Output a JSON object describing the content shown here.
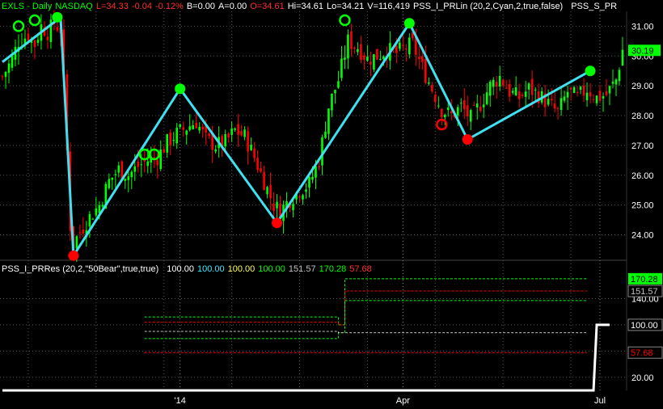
{
  "header_top": {
    "symbol": "EXLS - Daily",
    "exchange": "NASDAQ",
    "last": "L=34.33",
    "change": "-0.04",
    "change_pct": "-0.12%",
    "bid": "B=0.00",
    "ask": "A=0.00",
    "open": "O=34.61",
    "high": "Hi=34.61",
    "low": "Lo=34.21",
    "volume": "V=116,419",
    "study1": "PSS_I_PRLin (20,2,Cyan,2,true,false)",
    "study2": "PSS_S_PR"
  },
  "header_bottom": {
    "study": "PSS_I_PRRes (20,2,\"50Bear\",true,true)",
    "v1": "100.00",
    "v2": "100.00",
    "v3": "100.00",
    "v4": "100.00",
    "v5": "151.57",
    "v6": "170.28",
    "v7": "57.68"
  },
  "colors": {
    "background": "#000000",
    "up": "#00ff00",
    "down": "#ff0000",
    "line": "#3fe0f0",
    "header_green": "#00ff00",
    "header_red": "#ff3030",
    "header_white": "#ffffff",
    "cyan_text": "#40e8ff",
    "yellow_text": "#ffff60",
    "gray_text": "#c0c0c0",
    "price_badge": "#00ff00",
    "grid": "#555555"
  },
  "chart_data": [
    {
      "type": "candlestick",
      "x_tick_labels": [
        "'14",
        "Apr",
        "Jul"
      ],
      "y_ticks": [
        "31.00",
        "30.00",
        "29.00",
        "28.00",
        "27.00",
        "26.00",
        "25.00",
        "24.00"
      ],
      "ylim": [
        23.2,
        31.5
      ],
      "last_price_label": "30.19",
      "zigzag": [
        {
          "bar": 0,
          "value": 29.8
        },
        {
          "bar": 18,
          "value": 31.3
        },
        {
          "bar": 22,
          "value": 23.3
        },
        {
          "bar": 55,
          "value": 28.9
        },
        {
          "bar": 85,
          "value": 24.4
        },
        {
          "bar": 126,
          "value": 31.1
        },
        {
          "bar": 144,
          "value": 27.2
        },
        {
          "bar": 182,
          "value": 29.5
        }
      ],
      "pivot_markers": [
        {
          "bar": 5,
          "value": 31.0,
          "color": "up",
          "filled": false
        },
        {
          "bar": 10,
          "value": 31.2,
          "color": "up",
          "filled": false
        },
        {
          "bar": 17,
          "value": 31.3,
          "color": "up",
          "filled": true
        },
        {
          "bar": 22,
          "value": 23.3,
          "color": "down",
          "filled": true
        },
        {
          "bar": 44,
          "value": 26.7,
          "color": "up",
          "filled": false
        },
        {
          "bar": 47,
          "value": 26.7,
          "color": "up",
          "filled": false
        },
        {
          "bar": 55,
          "value": 28.9,
          "color": "up",
          "filled": true
        },
        {
          "bar": 85,
          "value": 24.4,
          "color": "down",
          "filled": true
        },
        {
          "bar": 106,
          "value": 31.2,
          "color": "up",
          "filled": false
        },
        {
          "bar": 126,
          "value": 31.1,
          "color": "up",
          "filled": true
        },
        {
          "bar": 136,
          "value": 27.7,
          "color": "down",
          "filled": false
        },
        {
          "bar": 144,
          "value": 27.2,
          "color": "down",
          "filled": true
        },
        {
          "bar": 182,
          "value": 29.5,
          "color": "up",
          "filled": true
        }
      ],
      "price_path": [
        [
          0,
          29.3
        ],
        [
          3,
          29.9
        ],
        [
          5,
          30.5
        ],
        [
          8,
          30.7
        ],
        [
          10,
          30.4
        ],
        [
          12,
          31.0
        ],
        [
          14,
          30.8
        ],
        [
          16,
          31.1
        ],
        [
          18,
          30.9
        ],
        [
          19,
          29.3
        ],
        [
          21,
          24.3
        ],
        [
          22,
          23.7
        ],
        [
          24,
          24.1
        ],
        [
          27,
          24.6
        ],
        [
          30,
          25.0
        ],
        [
          33,
          25.8
        ],
        [
          36,
          26.2
        ],
        [
          39,
          26.0
        ],
        [
          42,
          26.3
        ],
        [
          45,
          26.5
        ],
        [
          48,
          26.6
        ],
        [
          51,
          27.1
        ],
        [
          54,
          27.4
        ],
        [
          57,
          27.6
        ],
        [
          60,
          27.8
        ],
        [
          63,
          27.2
        ],
        [
          66,
          27.0
        ],
        [
          69,
          27.1
        ],
        [
          72,
          27.5
        ],
        [
          75,
          27.3
        ],
        [
          78,
          26.6
        ],
        [
          81,
          25.8
        ],
        [
          84,
          25.0
        ],
        [
          86,
          24.8
        ],
        [
          89,
          25.2
        ],
        [
          92,
          25.5
        ],
        [
          95,
          25.7
        ],
        [
          98,
          26.5
        ],
        [
          101,
          28.3
        ],
        [
          104,
          29.2
        ],
        [
          107,
          30.5
        ],
        [
          110,
          30.3
        ],
        [
          113,
          29.9
        ],
        [
          116,
          30.0
        ],
        [
          119,
          30.2
        ],
        [
          122,
          30.1
        ],
        [
          125,
          30.3
        ],
        [
          127,
          30.4
        ],
        [
          130,
          29.6
        ],
        [
          133,
          28.9
        ],
        [
          136,
          28.2
        ],
        [
          139,
          28.0
        ],
        [
          142,
          28.3
        ],
        [
          145,
          27.9
        ],
        [
          148,
          28.4
        ],
        [
          151,
          29.0
        ],
        [
          154,
          29.3
        ],
        [
          157,
          28.8
        ],
        [
          160,
          28.6
        ],
        [
          163,
          28.9
        ],
        [
          166,
          28.7
        ],
        [
          169,
          28.4
        ],
        [
          172,
          28.1
        ],
        [
          175,
          28.8
        ],
        [
          178,
          28.6
        ],
        [
          181,
          28.9
        ],
        [
          184,
          28.6
        ],
        [
          187,
          28.7
        ],
        [
          190,
          29.2
        ],
        [
          192,
          30.2
        ]
      ],
      "n_bars": 193
    },
    {
      "type": "line",
      "title": "PSS_I_PRRes (20,2,\"50Bear\",true,true)",
      "y_ticks": [
        "140.00",
        "20.00"
      ],
      "ylim": [
        0,
        180
      ],
      "value_labels": [
        {
          "text": "170.28",
          "value": 170.28,
          "color": "up",
          "box": false
        },
        {
          "text": "151.57",
          "value": 151.57,
          "color": "gray",
          "box": true
        },
        {
          "text": "100.00",
          "value": 100.0,
          "color": "white",
          "box": true
        },
        {
          "text": "57.68",
          "value": 57.68,
          "color": "down",
          "box": true
        }
      ],
      "res_line": [
        [
          0,
          0
        ],
        [
          183,
          0
        ],
        [
          184,
          100
        ],
        [
          188,
          100
        ]
      ],
      "dashed_series": [
        {
          "color": "up",
          "segments": [
            [
              44,
              104,
              112.0
            ],
            [
              104,
              106,
              100.0
            ],
            [
              106,
              181,
              170.28
            ]
          ]
        },
        {
          "color": "down",
          "segments": [
            [
              44,
              104,
              104.0
            ],
            [
              104,
              106,
              100.0
            ],
            [
              106,
              181,
              151.57
            ]
          ]
        },
        {
          "color": "up",
          "segments": [
            [
              44,
              104,
              79.0
            ],
            [
              104,
              106,
              88.0
            ],
            [
              106,
              181,
              137.0
            ]
          ]
        },
        {
          "color": "gray",
          "segments": [
            [
              44,
              104,
              90.0
            ],
            [
              104,
              106,
              88.0
            ],
            [
              106,
              181,
              88.0
            ]
          ]
        },
        {
          "color": "down",
          "segments": [
            [
              44,
              104,
              57.68
            ],
            [
              104,
              106,
              57.68
            ],
            [
              106,
              181,
              57.68
            ]
          ]
        }
      ]
    }
  ]
}
